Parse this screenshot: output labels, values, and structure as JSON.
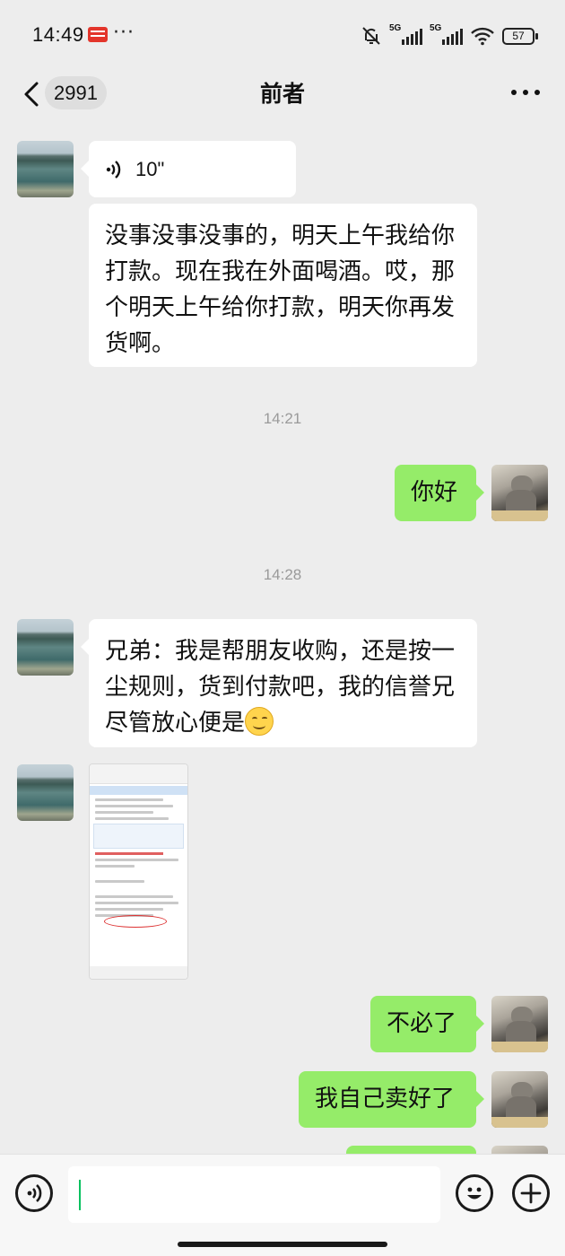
{
  "status_bar": {
    "time": "14:49",
    "more": "···",
    "network_1": "5G",
    "network_2": "5G",
    "battery": "57"
  },
  "header": {
    "unread_count": "2991",
    "title": "前者"
  },
  "messages": {
    "voice_duration": "10\"",
    "msg1": "没事没事没事的，明天上午我给你打款。现在我在外面喝酒。哎，那个明天上午给你打款，明天你再发货啊。",
    "time1": "14:21",
    "msg2": "你好",
    "time2": "14:28",
    "msg3": "兄弟：我是帮朋友收购，还是按一尘规则，货到付款吧，我的信誉兄尽管放心便是",
    "msg4": "不必了",
    "msg5": "我自己卖好了"
  },
  "input": {
    "value": ""
  },
  "icons": {
    "back": "chevron-left-icon",
    "more": "more-dots-icon",
    "voice": "voice-icon",
    "emoji": "smiley-icon",
    "plus": "plus-icon"
  },
  "colors": {
    "sent_bubble": "#95ec69",
    "received_bubble": "#ffffff",
    "background": "#ededed"
  }
}
